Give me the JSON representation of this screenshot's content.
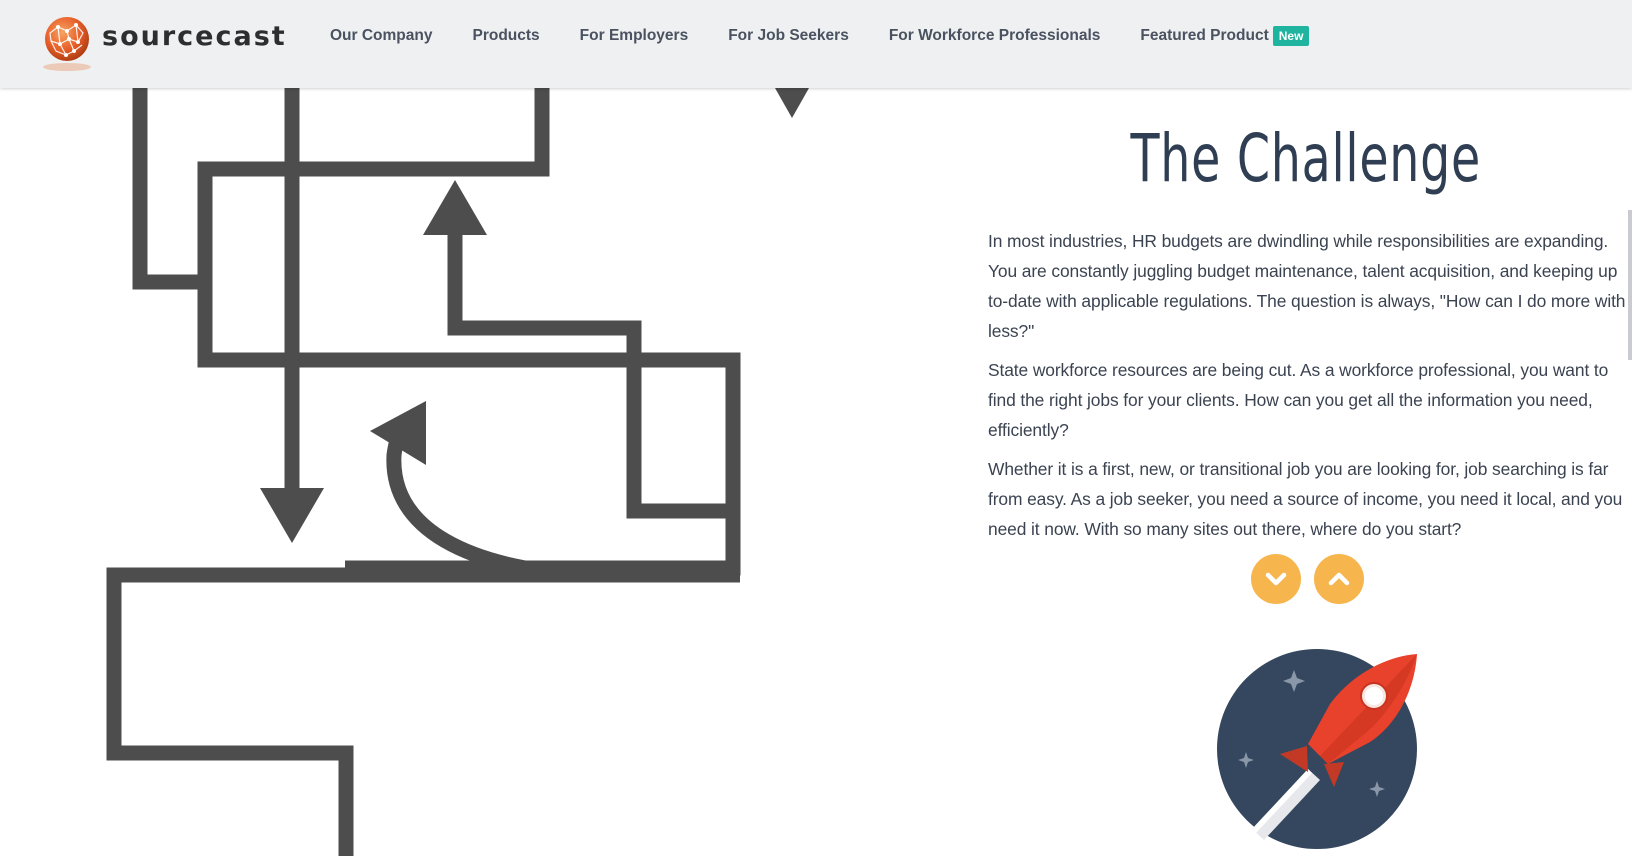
{
  "brand": {
    "name": "sourcecast",
    "logo_icon": "globe-logo-icon"
  },
  "nav": {
    "items": [
      {
        "label": "Our Company"
      },
      {
        "label": "Products"
      },
      {
        "label": "For Employers"
      },
      {
        "label": "For Job Seekers"
      },
      {
        "label": "For Workforce Professionals"
      },
      {
        "label": "Featured Product",
        "badge": "New"
      }
    ]
  },
  "main": {
    "title": "The Challenge",
    "paragraphs": [
      "In most industries, HR budgets are dwindling while responsibilities are expanding. You are constantly juggling budget maintenance, talent acquisition, and keeping up to-date with applicable regulations. The question is always, \"How can I do more with less?\"",
      "State workforce resources are being cut. As a workforce professional, you want to find the right jobs for your clients. How can you get all the information you need, efficiently?",
      "Whether it is a first, new, or transitional job you are looking for, job searching is far from easy. As a job seeker, you need a source of income, you need it local, and you need it now. With so many sites out there, where do you start?"
    ],
    "scroll_down_icon": "chevron-down-icon",
    "scroll_up_icon": "chevron-up-icon",
    "illustration_icon": "rocket-icon"
  },
  "colors": {
    "header_bg": "#eef0f2",
    "badge": "#1fb4a0",
    "accent_button": "#f7b54e",
    "title": "#2f3e52",
    "maze_stroke": "#4d4d4d",
    "rocket_circle": "#34475e",
    "rocket_body": "#e8412c"
  }
}
